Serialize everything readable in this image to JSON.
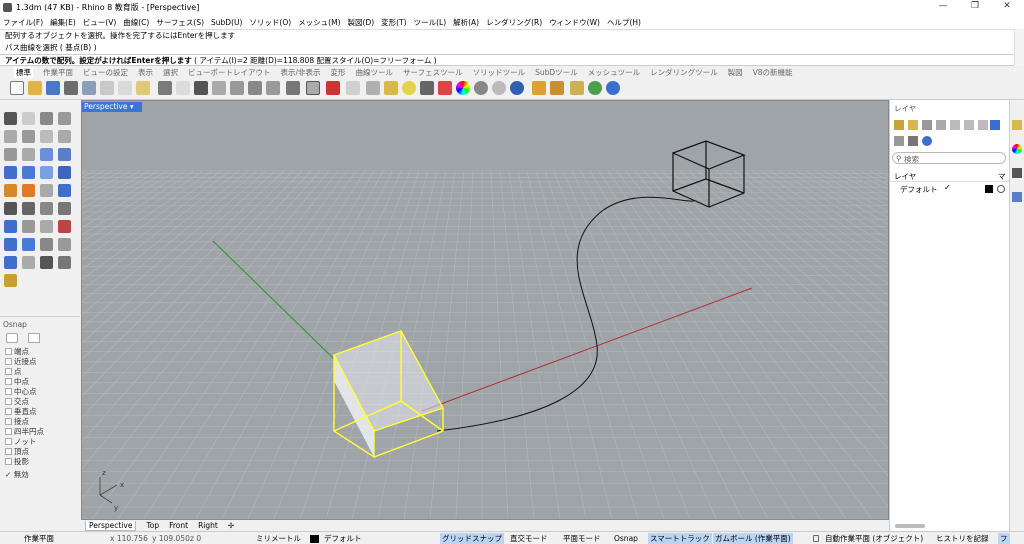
{
  "titlebar": {
    "title": "1.3dm (47 KB) - Rhino 8 教育版 - [Perspective]",
    "minimize": "—",
    "maximize": "❐",
    "close": "✕"
  },
  "menu": [
    "ファイル(F)",
    "編集(E)",
    "ビュー(V)",
    "曲線(C)",
    "サーフェス(S)",
    "SubD(U)",
    "ソリッド(O)",
    "メッシュ(M)",
    "製図(D)",
    "変形(T)",
    "ツール(L)",
    "解析(A)",
    "レンダリング(R)",
    "ウィンドウ(W)",
    "ヘルプ(H)"
  ],
  "history": [
    "配列するオブジェクトを選択。操作を完了するにはEnterを押します",
    "パス曲線を選択 ( 基点(B) )"
  ],
  "command": {
    "prompt": "アイテムの数で配列。設定がよければEnterを押します",
    "options": "( アイテム(I)=2  距離(D)=118.808  配置スタイル(O)=フリーフォーム )"
  },
  "tabs": [
    "標準",
    "作業平面",
    "ビューの設定",
    "表示",
    "選択",
    "ビューポートレイアウト",
    "表示/非表示",
    "変形",
    "曲線ツール",
    "サーフェスツール",
    "ソリッドツール",
    "SubDツール",
    "メッシュツール",
    "レンダリングツール",
    "製図",
    "V8の新機能"
  ],
  "viewport": {
    "label": "Perspective ▾",
    "axis_x": "x",
    "axis_y": "y",
    "axis_z": "z"
  },
  "view_tabs": [
    "Perspective",
    "Top",
    "Front",
    "Right",
    "✢"
  ],
  "osnap": {
    "title": "Osnap",
    "items": [
      "端点",
      "近接点",
      "点",
      "中点",
      "中心点",
      "交点",
      "垂直点",
      "接点",
      "四半円点",
      "ノット",
      "頂点",
      "投影"
    ],
    "disable": "無効",
    "disable_check": "✓"
  },
  "layers": {
    "title": "レイヤ",
    "search_placeholder": "検索",
    "col_name": "レイヤ",
    "col_m": "マ",
    "default_layer": "デフォルト",
    "check": "✓"
  },
  "status": {
    "cplane": "作業平面",
    "x": "x 110.756",
    "y": "y 109.050",
    "z": "z 0",
    "units": "ミリメートル",
    "layer": "デフォルト",
    "grid_snap": "グリッドスナップ",
    "ortho": "直交モード",
    "planar": "平面モード",
    "osnap": "Osnap",
    "smarttrack": "スマートトラック",
    "gumball": "ガムボール (作業平面)",
    "auto_cplane": "自動作業平面 (オブジェクト)",
    "history": "ヒストリを記録",
    "filter": "フ"
  },
  "colors": {
    "accent": "#3b74d6",
    "selection": "#ffff33",
    "grid_bg": "#9fa4a8",
    "x_axis": "#b03030",
    "y_axis": "#2f8f2f"
  }
}
